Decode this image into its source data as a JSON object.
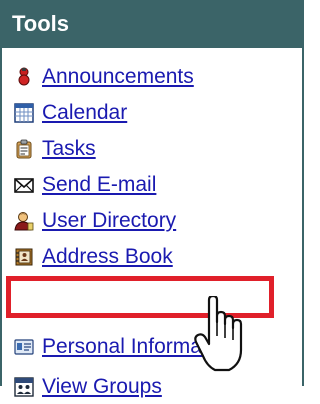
{
  "panel": {
    "title": "Tools",
    "header_color": "#3b6468",
    "link_color": "#1a1ab0",
    "highlight_color": "#e0202a"
  },
  "tools": [
    {
      "label": "Announcements",
      "icon": "announcements-icon"
    },
    {
      "label": "Calendar",
      "icon": "calendar-icon"
    },
    {
      "label": "Tasks",
      "icon": "tasks-icon"
    },
    {
      "label": "Send E-mail",
      "icon": "envelope-icon"
    },
    {
      "label": "User Directory",
      "icon": "user-directory-icon"
    },
    {
      "label": "Address Book",
      "icon": "address-book-icon"
    },
    {
      "label": "Personal Information",
      "icon": "personal-info-icon"
    },
    {
      "label": "View Groups",
      "icon": "groups-icon"
    }
  ]
}
